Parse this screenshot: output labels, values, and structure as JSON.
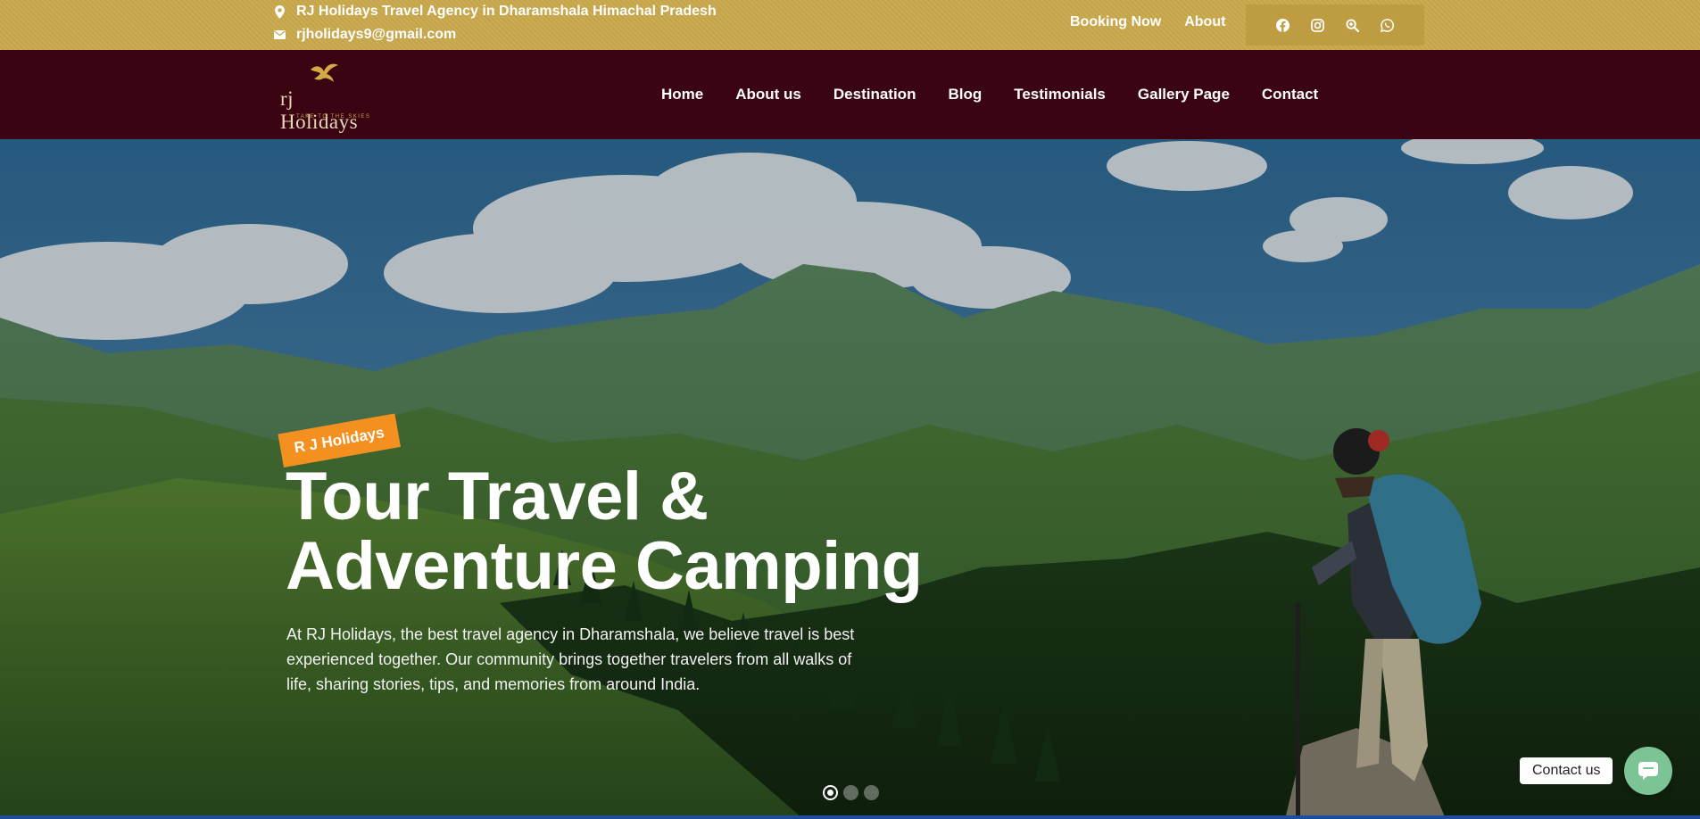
{
  "topbar": {
    "address": "RJ Holidays Travel Agency in Dharamshala Himachal Pradesh",
    "email": "rjholidays9@gmail.com",
    "links": [
      "Booking Now",
      "About"
    ],
    "social_icons": [
      "facebook-icon",
      "instagram-icon",
      "search-zoom-icon",
      "whatsapp-icon"
    ],
    "background_color": "#c9a94c"
  },
  "navbar": {
    "logo_text": "rj Holidays",
    "logo_tagline": "Take to the skies",
    "menu": [
      "Home",
      "About us",
      "Destination",
      "Blog",
      "Testimonials",
      "Gallery Page",
      "Contact"
    ],
    "background_color": "#3a0412"
  },
  "hero": {
    "badge": "R J Holidays",
    "title_line1": "Tour Travel &",
    "title_line2": "Adventure Camping",
    "description": "At RJ Holidays, the best travel agency in Dharamshala, we believe travel is best experienced together. Our community brings together travelers from all walks of life, sharing stories, tips, and memories from around India.",
    "slides_total": 3,
    "slide_active": 1,
    "badge_color": "#f39020"
  },
  "chat": {
    "label": "Contact us",
    "button_color": "#7cc496"
  }
}
